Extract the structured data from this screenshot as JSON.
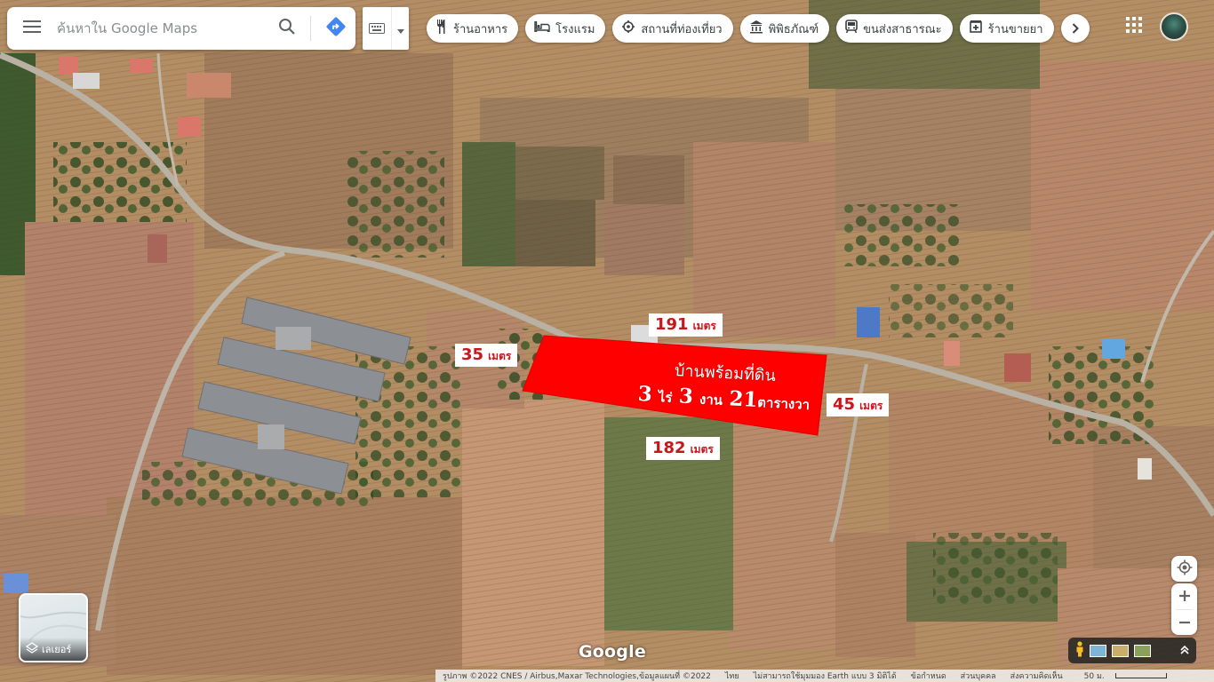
{
  "search": {
    "placeholder": "ค้นหาใน Google Maps"
  },
  "icons": {
    "menu": "menu-icon",
    "search": "search-icon",
    "directions": "directions-icon",
    "keyboard": "keyboard-icon",
    "apps": "apps-grid-icon",
    "layers": "layers-icon",
    "locate": "my-location-icon",
    "pegman": "pegman-icon"
  },
  "colors": {
    "plot_fill": "#ff0000",
    "label_text": "#c8161d",
    "directions_blue": "#4285f4"
  },
  "chips": [
    {
      "label": "ร้านอาหาร",
      "icon": "restaurant-icon"
    },
    {
      "label": "โรงแรม",
      "icon": "hotel-icon"
    },
    {
      "label": "สถานที่ท่องเที่ยว",
      "icon": "attraction-icon"
    },
    {
      "label": "พิพิธภัณฑ์",
      "icon": "museum-icon"
    },
    {
      "label": "ขนส่งสาธารณะ",
      "icon": "transit-icon"
    },
    {
      "label": "ร้านขายยา",
      "icon": "pharmacy-icon"
    }
  ],
  "plot": {
    "title": "บ้านพร้อมที่ดิน",
    "rai_value": "3",
    "rai_unit": "ไร่",
    "ngan_value": "3",
    "ngan_unit": "งาน",
    "wa_value": "21",
    "wa_unit": "ตารางวา",
    "sides": {
      "top": {
        "value": "191",
        "unit": "เมตร"
      },
      "left": {
        "value": "35",
        "unit": "เมตร"
      },
      "right": {
        "value": "45",
        "unit": "เมตร"
      },
      "bottom": {
        "value": "182",
        "unit": "เมตร"
      }
    }
  },
  "layers": {
    "label": "เลเยอร์"
  },
  "logo": "Google",
  "footer": {
    "imagery": "รูปภาพ ©2022 CNES / Airbus,Maxar Technologies,ข้อมูลแผนที่ ©2022",
    "language": "ไทย",
    "earth_notice": "ไม่สามารถใช้มุมมอง Earth แบบ 3 มิติได้",
    "terms": "ข้อกำหนด",
    "privacy": "ส่วนบุคคล",
    "feedback": "ส่งความคิดเห็น",
    "scale": "50 ม."
  }
}
